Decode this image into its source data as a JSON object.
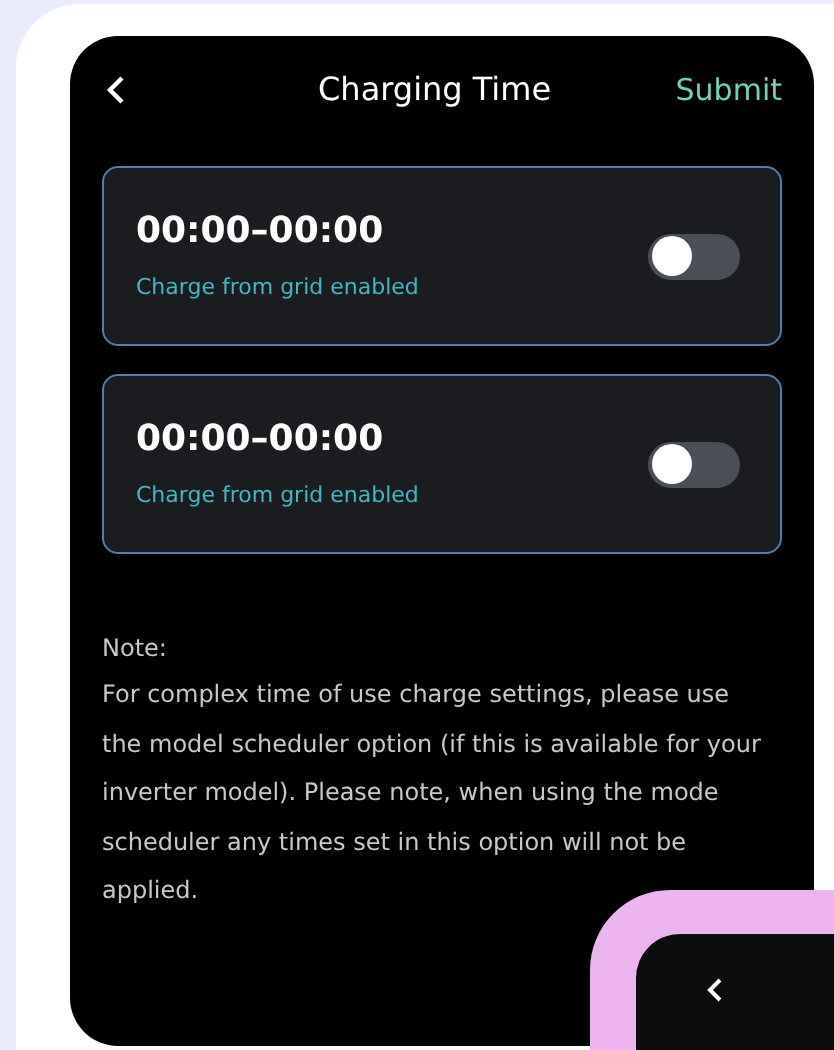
{
  "header": {
    "title": "Charging Time",
    "action": "Submit"
  },
  "slots": [
    {
      "time": "00:00–00:00",
      "caption": "Charge from grid enabled",
      "on": false
    },
    {
      "time": "00:00–00:00",
      "caption": "Charge from grid enabled",
      "on": false
    }
  ],
  "note": {
    "heading": "Note:",
    "text": "For complex time of use charge settings, please use the model scheduler option (if this is available for your inverter model). Please note, when using the mode scheduler any times set in this option will not be applied."
  }
}
